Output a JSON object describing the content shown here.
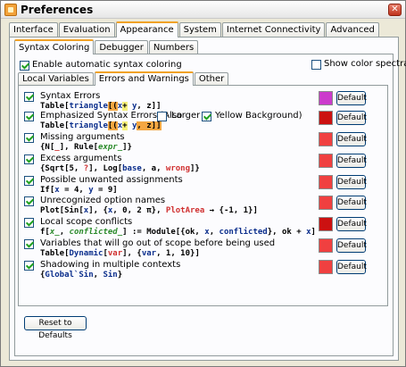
{
  "window": {
    "title": "Preferences",
    "close_glyph": "✕"
  },
  "main_tabs": [
    "Interface",
    "Evaluation",
    "Appearance",
    "System",
    "Internet Connectivity",
    "Advanced"
  ],
  "sub_tabs": [
    "Syntax Coloring",
    "Debugger",
    "Numbers"
  ],
  "enable_syntax": {
    "label": "Enable automatic syntax coloring",
    "checked": true
  },
  "show_spectra": {
    "label": "Show color spectra",
    "checked": false
  },
  "inner_tabs": [
    "Local Variables",
    "Errors and Warnings",
    "Other"
  ],
  "rows": [
    {
      "label": "Syntax Errors",
      "color": "#cc3bcc",
      "code": [
        [
          "Table[",
          ""
        ],
        [
          "triangle",
          "c-blue"
        ],
        [
          "[(",
          "hl-orange"
        ],
        [
          "x",
          "c-blue"
        ],
        [
          "+",
          "hl-yellow"
        ],
        [
          " ",
          ""
        ],
        [
          "y",
          "c-blue"
        ],
        [
          ", z]]",
          ""
        ]
      ]
    },
    {
      "label": "Emphasized Syntax Errors  (Also",
      "extra": {
        "larger": "Larger",
        "yellow": "Yellow Background)"
      },
      "color": "#cc1111",
      "code": [
        [
          "Table[",
          ""
        ],
        [
          "triangle",
          "c-blue"
        ],
        [
          "[(",
          "hl-orange"
        ],
        [
          "x",
          "c-blue"
        ],
        [
          "+",
          "hl-yellow"
        ],
        [
          " ",
          ""
        ],
        [
          "y",
          "c-blue"
        ],
        [
          ", z]]",
          "hl-orange"
        ]
      ]
    },
    {
      "label": "Missing arguments",
      "color": "#f04040",
      "code": [
        [
          "{N[",
          ""
        ],
        [
          "_",
          "c-red"
        ],
        [
          "], Rule[",
          ""
        ],
        [
          "expr_",
          "c-italic-green"
        ],
        [
          "]}",
          ""
        ]
      ]
    },
    {
      "label": "Excess arguments",
      "color": "#f04040",
      "code": [
        [
          "{Sqrt[5, ",
          ""
        ],
        [
          "?",
          "c-red"
        ],
        [
          "], Log[",
          ""
        ],
        [
          "base",
          "c-blue"
        ],
        [
          ", a, ",
          ""
        ],
        [
          "wrong",
          "c-red"
        ],
        [
          "]}",
          ""
        ]
      ]
    },
    {
      "label": "Possible unwanted assignments",
      "color": "#f04040",
      "code": [
        [
          "If[",
          ""
        ],
        [
          "x",
          "c-blue"
        ],
        [
          " = 4, ",
          ""
        ],
        [
          "y",
          "c-blue"
        ],
        [
          " = 9]",
          ""
        ]
      ]
    },
    {
      "label": "Unrecognized option names",
      "color": "#f04040",
      "code": [
        [
          "Plot[Sin[",
          ""
        ],
        [
          "x",
          "c-blue"
        ],
        [
          "], {",
          ""
        ],
        [
          "x",
          "c-blue"
        ],
        [
          ", 0, 2 π}, ",
          ""
        ],
        [
          "PlotArea",
          "c-red"
        ],
        [
          " → {-1, 1}]",
          ""
        ]
      ]
    },
    {
      "label": "Local scope conflicts",
      "color": "#cc1111",
      "code": [
        [
          "f[",
          ""
        ],
        [
          "x_",
          "c-italic-green"
        ],
        [
          ", ",
          ""
        ],
        [
          "conflicted_",
          "c-italic-green"
        ],
        [
          "] := Module[{ok, ",
          ""
        ],
        [
          "x",
          "c-blue"
        ],
        [
          ", ",
          ""
        ],
        [
          "conflicted",
          "c-blue"
        ],
        [
          "}, ok + ",
          ""
        ],
        [
          "x",
          "c-blue"
        ],
        [
          "]",
          ""
        ]
      ]
    },
    {
      "label": "Variables that will go out of scope before being used",
      "color": "#f04040",
      "code": [
        [
          "Table[",
          ""
        ],
        [
          "Dynamic",
          "c-blue"
        ],
        [
          "[",
          ""
        ],
        [
          "var",
          "c-red"
        ],
        [
          "], {",
          ""
        ],
        [
          "var",
          "c-blue"
        ],
        [
          ", 1, 10}]",
          ""
        ]
      ]
    },
    {
      "label": "Shadowing in multiple contexts",
      "color": "#f04040",
      "code": [
        [
          "{",
          ""
        ],
        [
          "Global`Sin",
          "c-blue"
        ],
        [
          ", ",
          ""
        ],
        [
          "Sin",
          "c-blue"
        ],
        [
          "}",
          ""
        ]
      ]
    }
  ],
  "default_label": "Default",
  "reset_label": "Reset to Defaults"
}
